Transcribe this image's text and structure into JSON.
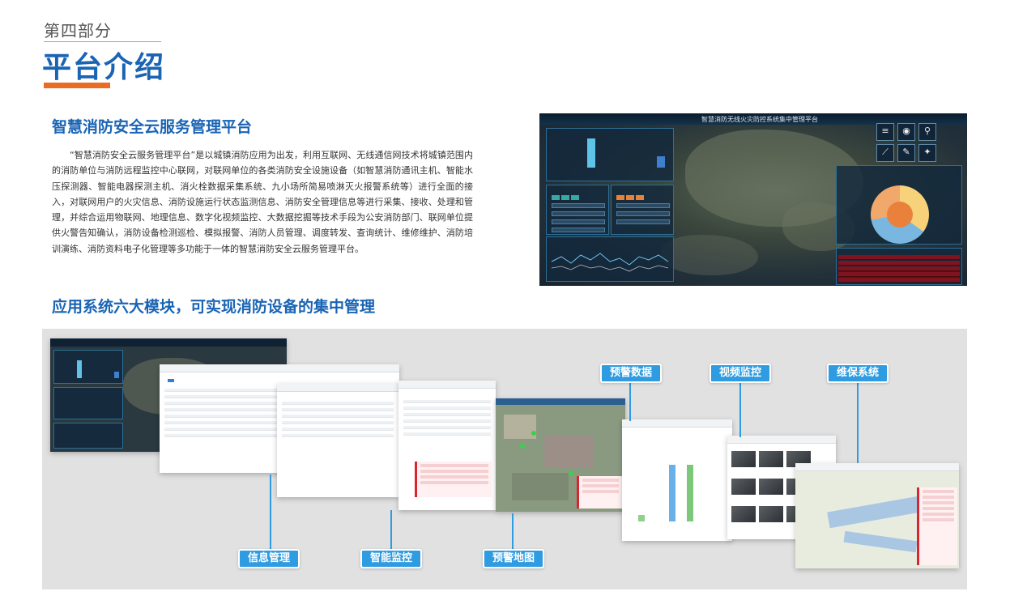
{
  "header": {
    "section_label": "第四部分",
    "title": "平台介绍"
  },
  "intro": {
    "heading": "智慧消防安全云服务管理平台",
    "paragraph": "“智慧消防安全云服务管理平台”是以城镇消防应用为出发，利用互联网、无线通信网技术将城镇范围内的消防单位与消防远程监控中心联网，对联网单位的各类消防安全设施设备（如智慧消防通讯主机、智能水压探测器、智能电器探测主机、消火栓数据采集系统、九小场所简易喷淋灭火报警系统等）进行全面的接入，对联网用户的火灾信息、消防设施运行状态监测信息、消防安全管理信息等进行采集、接收、处理和管理，并综合运用物联网、地理信息、数字化视频监控、大数据挖掘等技术手段为公安消防部门、联网单位提供火警告知确认，消防设备检测巡检、模拟报警、消防人员管理、调度转发、查询统计、维修维护、消防培训演练、消防资料电子化管理等多功能于一体的智慧消防安全云服务管理平台。"
  },
  "dashboard": {
    "window_title": "智慧消防无线火灾防控系统集中管理平台"
  },
  "modules": {
    "heading": "应用系统六大模块，可实现消防设备的集中管理",
    "items": [
      {
        "label": "信息管理"
      },
      {
        "label": "智能监控"
      },
      {
        "label": "预警地图"
      },
      {
        "label": "预警数据"
      },
      {
        "label": "视频监控"
      },
      {
        "label": "维保系统"
      }
    ]
  },
  "colors": {
    "brand_blue": "#1a64b4",
    "accent_orange": "#ec6b23",
    "tag_blue": "#2f9be0",
    "alarm_red": "#d9252f"
  }
}
